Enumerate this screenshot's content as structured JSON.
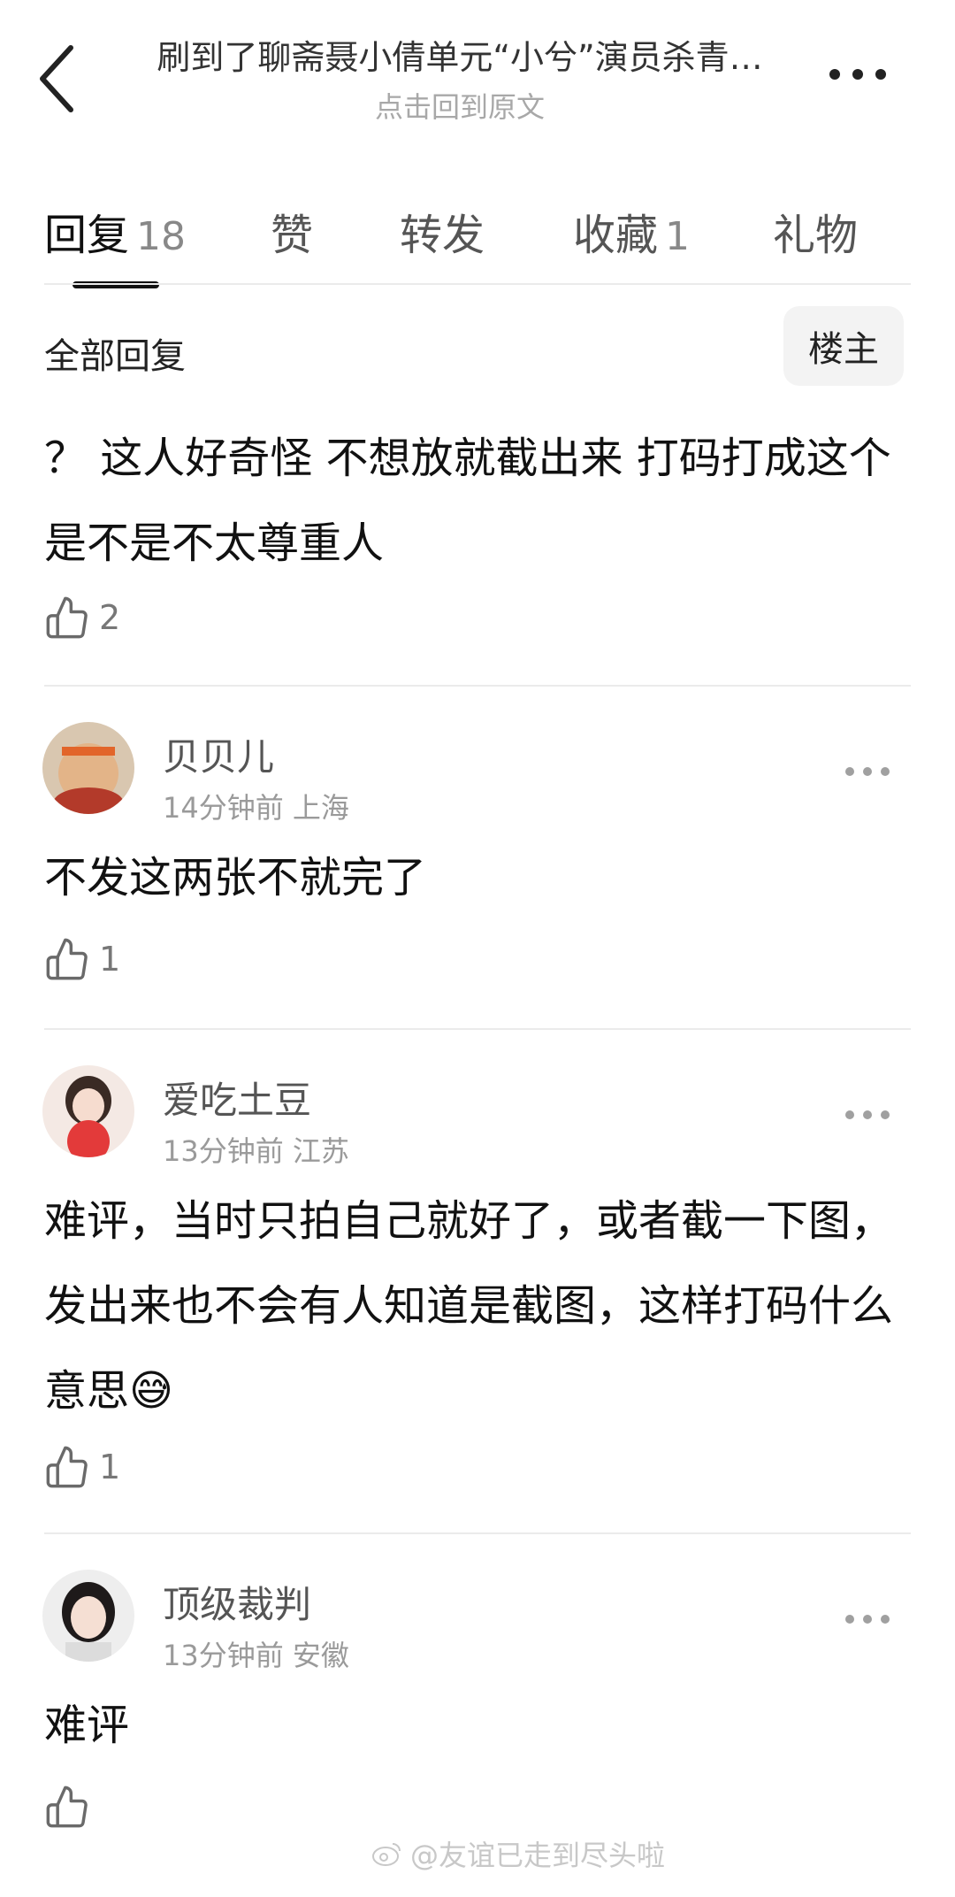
{
  "header": {
    "title": "刷到了聊斋聂小倩单元“小兮”演员杀青…",
    "subtitle": "点击回到原文"
  },
  "tabs": [
    {
      "label": "回复",
      "count": "18"
    },
    {
      "label": "赞",
      "count": ""
    },
    {
      "label": "转发",
      "count": ""
    },
    {
      "label": "收藏",
      "count": "1"
    },
    {
      "label": "礼物",
      "count": ""
    }
  ],
  "filter": {
    "all_label": "全部回复",
    "op_label": "楼主"
  },
  "main_post": {
    "text": "？ 这人好奇怪 不想放就截出来 打码打成这个是不是不太尊重人",
    "likes": "2"
  },
  "comments": [
    {
      "name": "贝贝儿",
      "time": "14分钟前",
      "location": "上海",
      "text": "不发这两张不就完了",
      "likes": "1"
    },
    {
      "name": "爱吃土豆",
      "time": "13分钟前",
      "location": "江苏",
      "text": "难评，当时只拍自己就好了，或者截一下图，发出来也不会有人知道是截图，这样打码什么意思😅",
      "likes": "1"
    },
    {
      "name": "顶级裁判",
      "time": "13分钟前",
      "location": "安徽",
      "text": "难评",
      "likes": ""
    }
  ],
  "watermark": "@友谊已走到尽头啦",
  "colors": {
    "primary_text": "#111111",
    "secondary_text": "#9a9a9a",
    "divider": "#ebebeb",
    "button_bg": "#f3f3f3"
  }
}
